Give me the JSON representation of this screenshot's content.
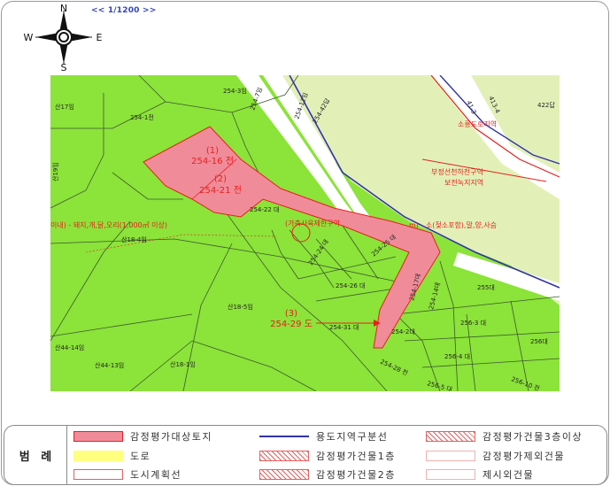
{
  "compass": {
    "north": "N",
    "south": "S",
    "east": "E",
    "west": "W"
  },
  "scale_text": "<< 1/1200 >>",
  "map": {
    "parcels": {
      "p1": "(1)",
      "p1_num": "254-16 전",
      "p2": "(2)",
      "p2_num": "254-21 전",
      "p3": "(3)",
      "p3_num": "254-29 도"
    },
    "lot_labels": [
      "254-3임",
      "254-1전",
      "산17임",
      "254-7임",
      "254-12임",
      "254-42답",
      "산19임",
      "254-22 대",
      "산18-4임",
      "254-24 대",
      "254-25 대",
      "254-26 대",
      "254-31 대",
      "254-2대",
      "254-28 전",
      "산18-5임",
      "산44-14임",
      "산44-13임",
      "산18-1임",
      "255대",
      "256-3 대",
      "256-4 대",
      "256-5 대",
      "256-10 전",
      "256대",
      "422답",
      "413-4",
      "41-3",
      "254-17대",
      "254-14대"
    ],
    "zone_labels": {
      "z1": "소릉도로지역",
      "z2": "부정선천하천구역",
      "z3": "보전녹지지역"
    },
    "annotation_left": "이내) - 돼지,개,닭,오리(1,000㎡ 이상)",
    "annotation_mid": "(가축사육제한구역",
    "annotation_right": "m) - 소(젖소포함),말,양,사슴"
  },
  "legend": {
    "title": "범 례",
    "items": [
      {
        "label": "감정평가대상토지",
        "color": "#f08c9a"
      },
      {
        "label": "용도지역구분선",
        "color": "#3333aa"
      },
      {
        "label": "감정평가건물3층이상",
        "color": "#e46060"
      },
      {
        "label": "도로",
        "color": "#ffff80"
      },
      {
        "label": "감정평가건물1층",
        "color": "#e46060"
      },
      {
        "label": "감정평가제외건물",
        "color": "#f4b0b0"
      },
      {
        "label": "도시계획선",
        "color": "#e46060"
      },
      {
        "label": "감정평가건물2층",
        "color": "#e46060"
      },
      {
        "label": "제시외건물",
        "color": "#f4b0b0"
      }
    ]
  }
}
